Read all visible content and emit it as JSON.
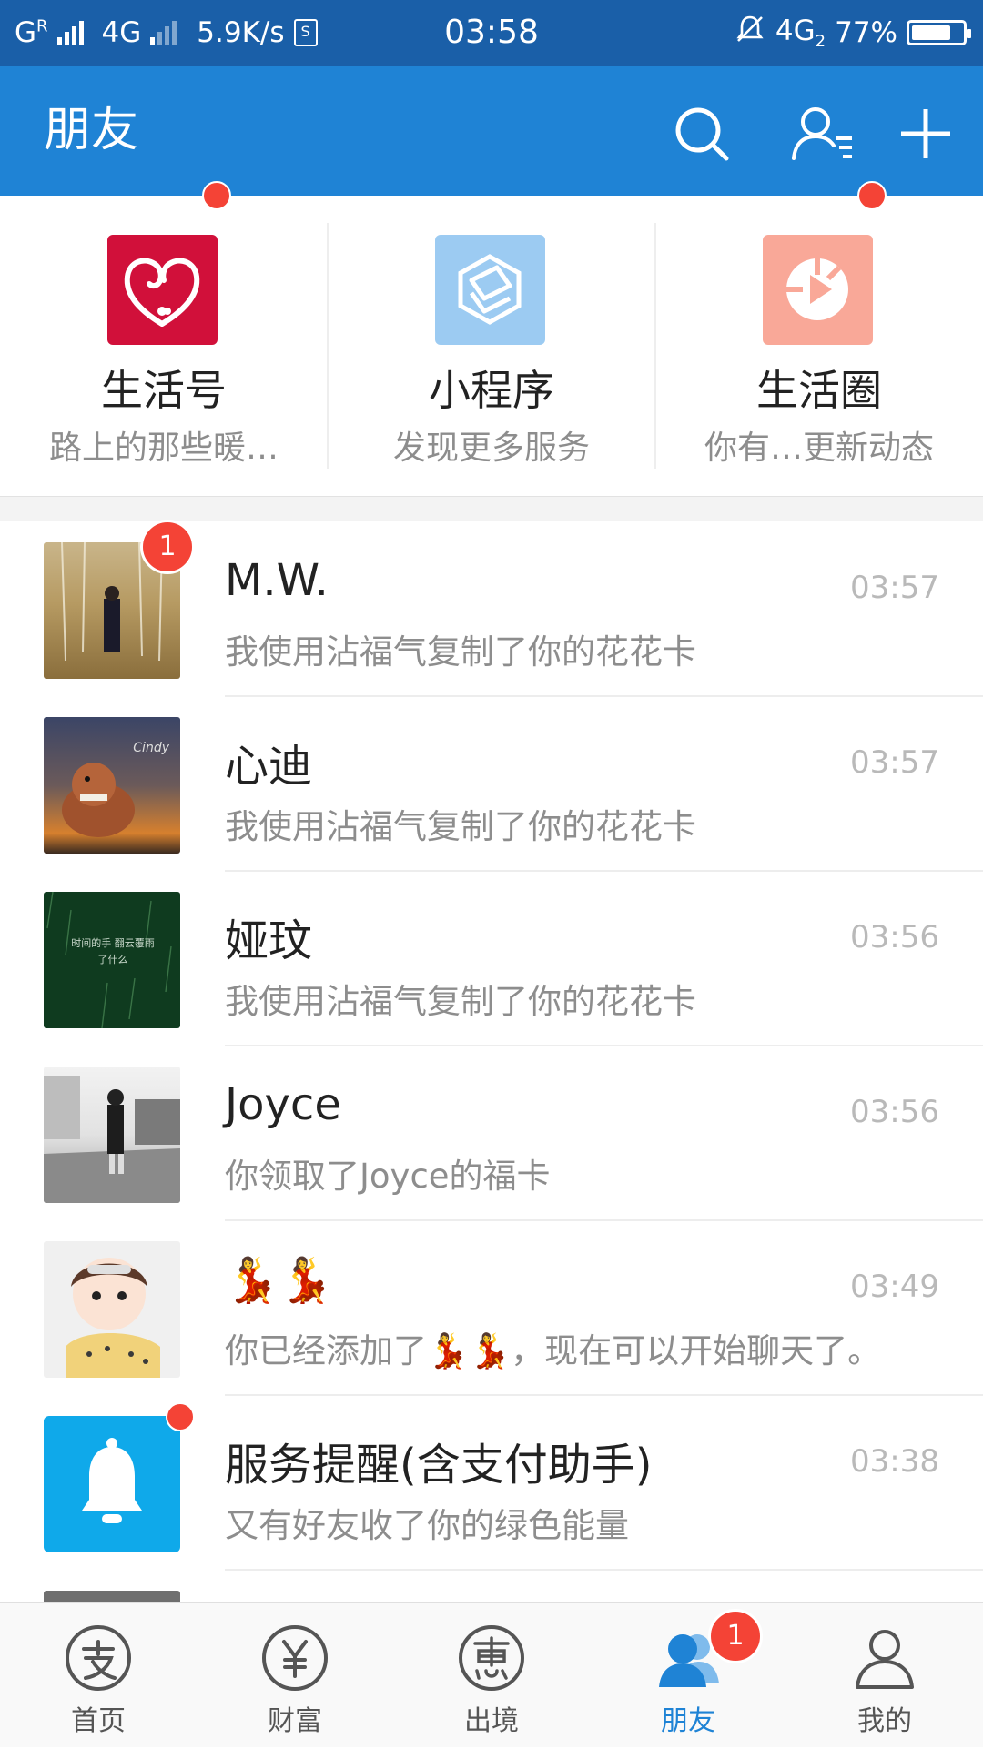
{
  "status_bar": {
    "carrier1": "G",
    "carrier1_sup": "R",
    "network": "4G",
    "speed": "5.9K/s",
    "time": "03:58",
    "network2": "4G",
    "network2_sub": "2",
    "battery": "77%",
    "battery_level": 0.77
  },
  "header": {
    "title": "朋友",
    "icons": [
      "search-icon",
      "contacts-icon",
      "plus-icon"
    ]
  },
  "shortcuts": [
    {
      "name": "生活号",
      "desc": "路上的那些暖…",
      "icon": "life-account-icon",
      "color": "#d1103a",
      "dot": true
    },
    {
      "name": "小程序",
      "desc": "发现更多服务",
      "icon": "mini-program-icon",
      "color": "#9ccbf2",
      "dot": false
    },
    {
      "name": "生活圈",
      "desc": "你有…更新动态",
      "icon": "life-circle-icon",
      "color": "#f9a898",
      "dot": true
    }
  ],
  "chats": [
    {
      "name": "M.W.",
      "message": "我使用沾福气复制了你的花花卡",
      "time": "03:57",
      "badge": "1"
    },
    {
      "name": "心迪",
      "message": "我使用沾福气复制了你的花花卡",
      "time": "03:57",
      "avatar_text": "Cindy"
    },
    {
      "name": "娅玟",
      "message": "我使用沾福气复制了你的花花卡",
      "time": "03:56",
      "avatar_text": "时间的手 翻云覆雨了什么"
    },
    {
      "name": "Joyce",
      "message": "你领取了Joyce的福卡",
      "time": "03:56"
    },
    {
      "name": "💃💃",
      "message": "你已经添加了💃💃，现在可以开始聊天了。",
      "time": "03:49"
    },
    {
      "name": "服务提醒(含支付助手)",
      "message": "又有好友收了你的绿色能量",
      "time": "03:38",
      "dot": true
    }
  ],
  "bottom_nav": [
    {
      "label": "首页",
      "icon": "alipay-home-icon",
      "active": false
    },
    {
      "label": "财富",
      "icon": "yen-icon",
      "active": false
    },
    {
      "label": "出境",
      "icon": "discount-icon",
      "active": false
    },
    {
      "label": "朋友",
      "icon": "friends-icon",
      "active": true,
      "badge": "1"
    },
    {
      "label": "我的",
      "icon": "profile-icon",
      "active": false
    }
  ],
  "colors": {
    "status_bar": "#1a5fa8",
    "title_bar": "#1f83d5",
    "badge_red": "#f44336",
    "active_tab": "#1f83d5"
  }
}
